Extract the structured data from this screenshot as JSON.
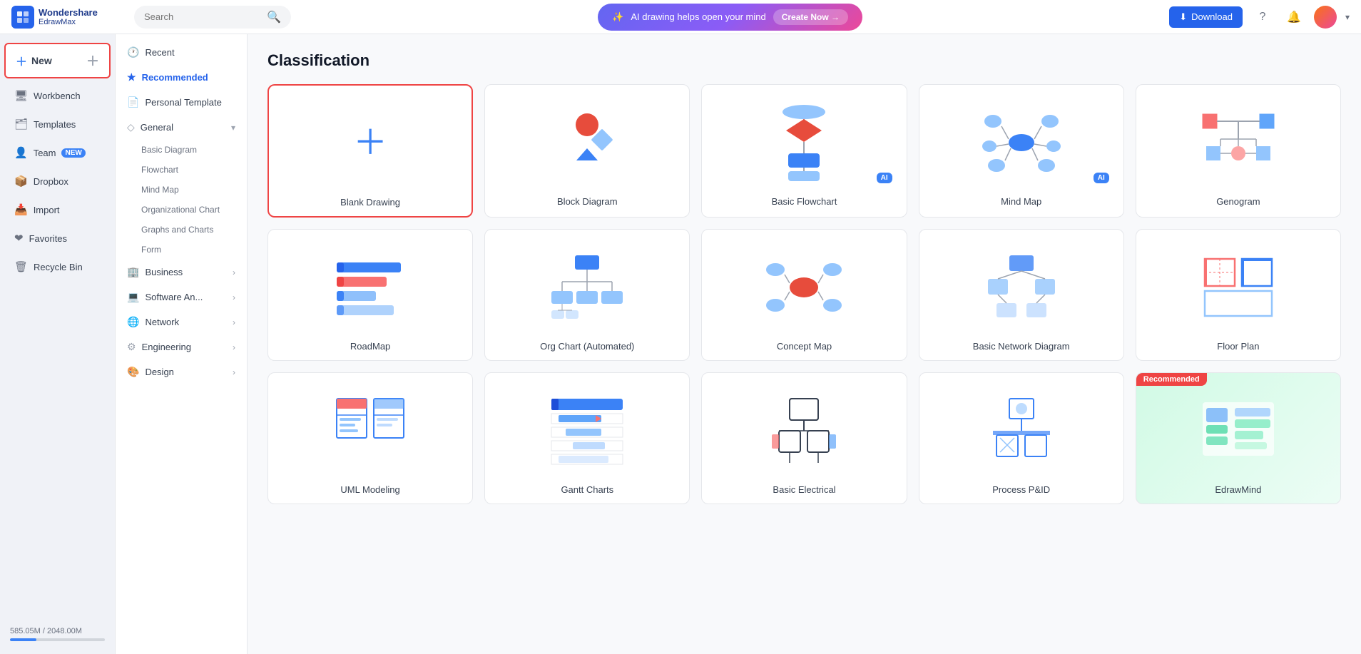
{
  "app": {
    "logo_line1": "Wondershare",
    "logo_line2": "EdrawMax"
  },
  "topbar": {
    "search_placeholder": "Search",
    "ai_text": "AI drawing helps open your mind",
    "create_now": "Create Now →",
    "download_label": "Download"
  },
  "sidebar": {
    "new_label": "New",
    "items": [
      {
        "id": "workbench",
        "label": "Workbench",
        "icon": "🖥"
      },
      {
        "id": "templates",
        "label": "Templates",
        "icon": "🗂"
      },
      {
        "id": "team",
        "label": "Team",
        "icon": "👤",
        "badge": "NEW"
      },
      {
        "id": "dropbox",
        "label": "Dropbox",
        "icon": "📦"
      },
      {
        "id": "import",
        "label": "Import",
        "icon": "📥"
      },
      {
        "id": "favorites",
        "label": "Favorites",
        "icon": "❤"
      },
      {
        "id": "recycle",
        "label": "Recycle Bin",
        "icon": "🗑"
      }
    ],
    "storage_label": "585.05M / 2048.00M",
    "storage_pct": 28
  },
  "nav": {
    "items": [
      {
        "id": "recent",
        "label": "Recent",
        "icon": "🕐",
        "active": false
      },
      {
        "id": "recommended",
        "label": "Recommended",
        "icon": "★",
        "active": true
      },
      {
        "id": "personal",
        "label": "Personal Template",
        "icon": "📄",
        "active": false
      }
    ],
    "sections": [
      {
        "id": "general",
        "label": "General",
        "expanded": true,
        "sub_items": [
          "Basic Diagram",
          "Flowchart",
          "Mind Map",
          "Organizational Chart",
          "Graphs and Charts",
          "Form"
        ]
      },
      {
        "id": "business",
        "label": "Business",
        "expanded": false,
        "sub_items": []
      },
      {
        "id": "software",
        "label": "Software An...",
        "expanded": false,
        "sub_items": []
      },
      {
        "id": "network",
        "label": "Network",
        "expanded": false,
        "sub_items": []
      },
      {
        "id": "engineering",
        "label": "Engineering",
        "expanded": false,
        "sub_items": []
      },
      {
        "id": "design",
        "label": "Design",
        "expanded": false,
        "sub_items": []
      }
    ]
  },
  "content": {
    "title": "Classification",
    "templates": [
      {
        "id": "blank",
        "label": "Blank Drawing",
        "type": "blank"
      },
      {
        "id": "block",
        "label": "Block Diagram",
        "type": "block",
        "ai": false
      },
      {
        "id": "flowchart",
        "label": "Basic Flowchart",
        "type": "flowchart",
        "ai": true
      },
      {
        "id": "mindmap",
        "label": "Mind Map",
        "type": "mindmap",
        "ai": true
      },
      {
        "id": "genogram",
        "label": "Genogram",
        "type": "genogram",
        "ai": false
      },
      {
        "id": "roadmap",
        "label": "RoadMap",
        "type": "roadmap",
        "ai": false
      },
      {
        "id": "orgchart",
        "label": "Org Chart (Automated)",
        "type": "orgchart",
        "ai": false
      },
      {
        "id": "concept",
        "label": "Concept Map",
        "type": "concept",
        "ai": false
      },
      {
        "id": "network",
        "label": "Basic Network Diagram",
        "type": "network",
        "ai": false
      },
      {
        "id": "floorplan",
        "label": "Floor Plan",
        "type": "floorplan",
        "ai": false
      },
      {
        "id": "uml",
        "label": "UML Modeling",
        "type": "uml",
        "ai": false
      },
      {
        "id": "gantt",
        "label": "Gantt Charts",
        "type": "gantt",
        "ai": false
      },
      {
        "id": "electrical",
        "label": "Basic Electrical",
        "type": "electrical",
        "ai": false
      },
      {
        "id": "pid",
        "label": "Process P&ID",
        "type": "pid",
        "ai": false
      },
      {
        "id": "edrawmind",
        "label": "EdrawMind",
        "type": "edrawmind",
        "recommended": true
      }
    ]
  }
}
